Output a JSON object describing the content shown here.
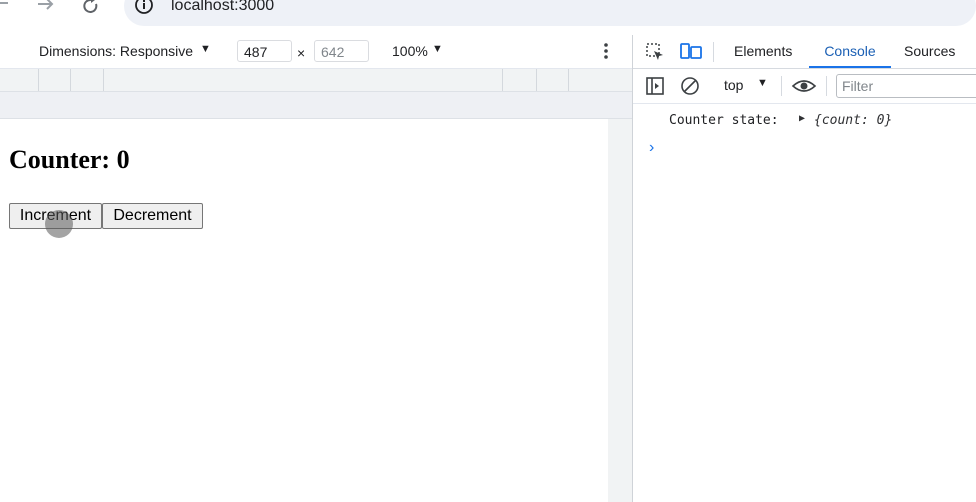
{
  "browser": {
    "url": "localhost:3000"
  },
  "device_toolbar": {
    "dimensions_label": "Dimensions: Responsive",
    "width_value": "487",
    "height_value": "642",
    "zoom_label": "100%",
    "times_symbol": "×"
  },
  "page": {
    "title": "Counter: 0",
    "buttons": {
      "increment": "Increment",
      "decrement": "Decrement"
    }
  },
  "devtools": {
    "tabs": [
      {
        "label": "Elements",
        "active": false
      },
      {
        "label": "Console",
        "active": true
      },
      {
        "label": "Sources",
        "active": false
      }
    ],
    "console_toolbar": {
      "context": "top",
      "filter_placeholder": "Filter"
    },
    "console": {
      "log_label": "Counter state:",
      "log_object": "{count: 0}",
      "prompt": "›"
    }
  },
  "colors": {
    "accent": "#1a73e8",
    "url_bar_bg": "#eef1f7"
  }
}
